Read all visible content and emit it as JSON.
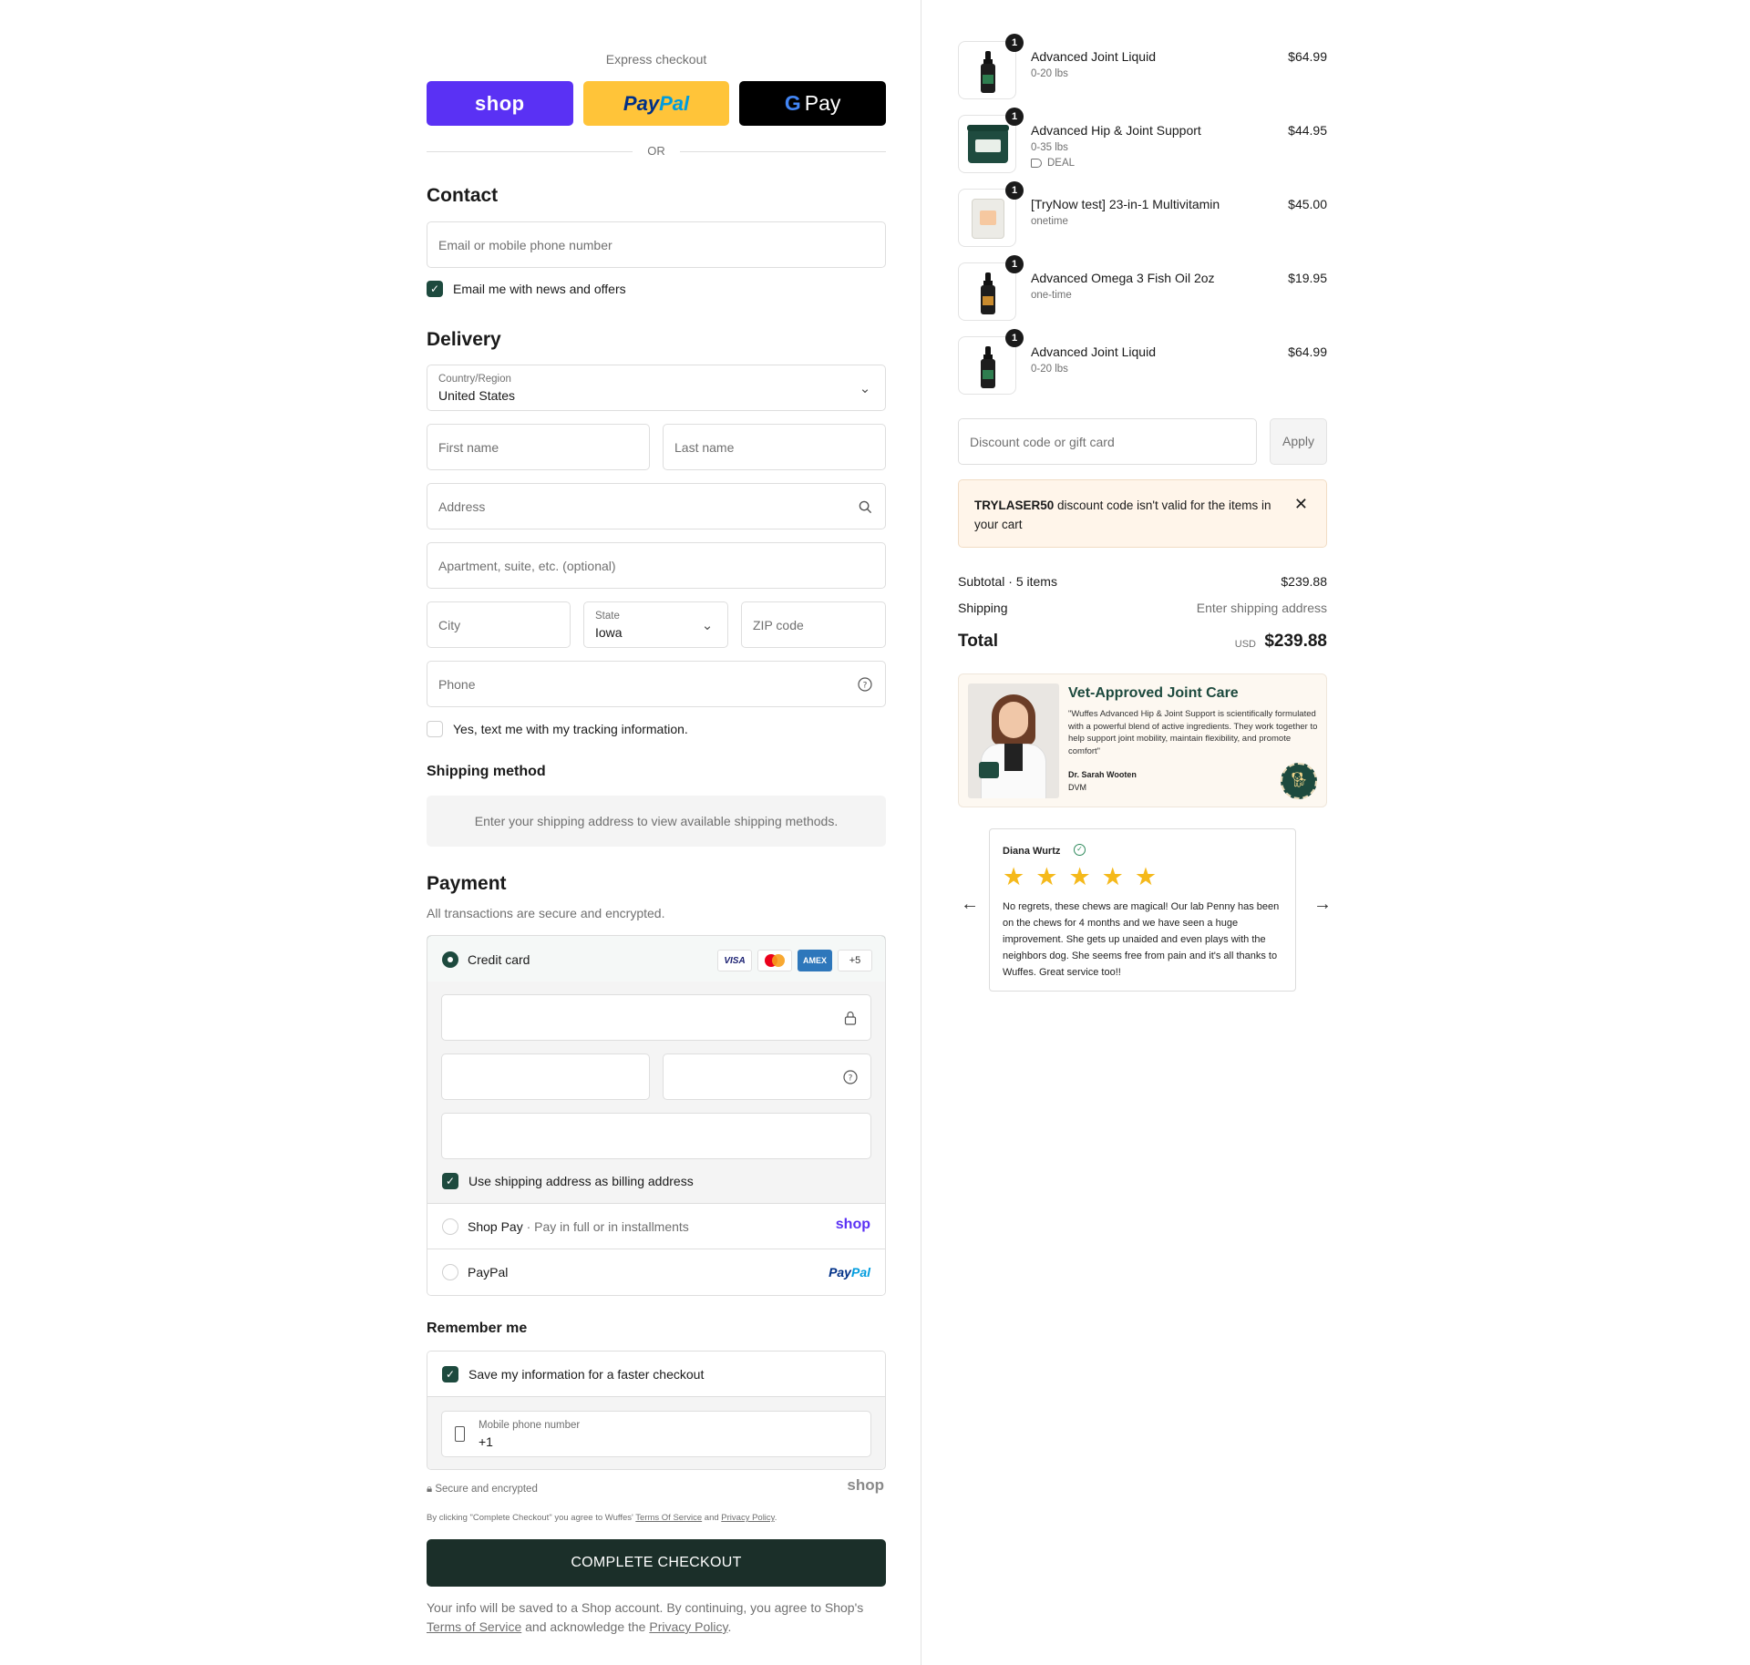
{
  "express": {
    "label": "Express checkout",
    "shop": "shop",
    "paypal_a": "Pay",
    "paypal_b": "Pal",
    "gpay_g": "G",
    "gpay": "Pay",
    "or": "OR"
  },
  "contact": {
    "title": "Contact",
    "email_placeholder": "Email or mobile phone number",
    "newsletter": "Email me with news and offers",
    "newsletter_checked": true
  },
  "delivery": {
    "title": "Delivery",
    "country_label": "Country/Region",
    "country_value": "United States",
    "first_name": "First name",
    "last_name": "Last name",
    "address": "Address",
    "apartment": "Apartment, suite, etc. (optional)",
    "city": "City",
    "state_label": "State",
    "state_value": "Iowa",
    "zip": "ZIP code",
    "phone": "Phone",
    "text_tracking": "Yes, text me with my tracking information."
  },
  "shipping": {
    "title": "Shipping method",
    "message": "Enter your shipping address to view available shipping methods."
  },
  "payment": {
    "title": "Payment",
    "subtitle": "All transactions are secure and encrypted.",
    "credit_card": "Credit card",
    "cards": [
      "VISA",
      "AMEX",
      "+5"
    ],
    "billing_same": "Use shipping address as billing address",
    "shop_pay": "Shop Pay",
    "shop_pay_sep": "·",
    "shop_pay_sub": "Pay in full or in installments",
    "shop_brand": "shop",
    "paypal": "PayPal",
    "paypal_brand_a": "Pay",
    "paypal_brand_b": "Pal"
  },
  "remember": {
    "title": "Remember me",
    "save_info": "Save my information for a faster checkout",
    "mobile_label": "Mobile phone number",
    "mobile_value": "+1"
  },
  "footer": {
    "secure": "Secure and encrypted",
    "shop_brand": "shop",
    "legal_pre": "By clicking \"Complete Checkout\" you agree to Wuffes'",
    "legal_terms": "Terms Of Service",
    "legal_and": "and",
    "legal_privacy": "Privacy Policy",
    "legal_end": ".",
    "cta": "COMPLETE CHECKOUT",
    "note_a": "Your info will be saved to a Shop account. By continuing, you agree to Shop's",
    "note_terms": "Terms of Service",
    "note_b": "and acknowledge the",
    "note_privacy": "Privacy Policy",
    "note_end": "."
  },
  "cart": {
    "items": [
      {
        "qty": "1",
        "name": "Advanced Joint Liquid",
        "variant": "0-20 lbs",
        "price": "$64.99",
        "image": "bottle"
      },
      {
        "qty": "1",
        "name": "Advanced Hip & Joint Support",
        "variant": "0-35 lbs",
        "deal": "DEAL",
        "price": "$44.95",
        "image": "jar"
      },
      {
        "qty": "1",
        "name": "[TryNow test] 23-in-1 Multivitamin",
        "variant": "onetime",
        "price": "$45.00",
        "image": "bag"
      },
      {
        "qty": "1",
        "name": "Advanced Omega 3 Fish Oil 2oz",
        "variant": "one-time",
        "price": "$19.95",
        "image": "bottle"
      },
      {
        "qty": "1",
        "name": "Advanced Joint Liquid",
        "variant": "0-20 lbs",
        "price": "$64.99",
        "image": "bottle"
      }
    ],
    "discount_placeholder": "Discount code or gift card",
    "apply": "Apply",
    "alert_code": "TRYLASER50",
    "alert_msg": "discount code isn't valid for the items in your cart",
    "subtotal_label": "Subtotal · 5 items",
    "subtotal": "$239.88",
    "shipping_label": "Shipping",
    "shipping_value": "Enter shipping address",
    "total_label": "Total",
    "currency": "USD",
    "total": "$239.88"
  },
  "vet": {
    "title": "Vet-Approved Joint Care",
    "quote": "\"Wuffes Advanced Hip & Joint Support is scientifically formulated with a powerful blend of active ingredients. They work together to help support joint mobility, maintain flexibility, and promote comfort\"",
    "name": "Dr. Sarah Wooten",
    "credential": "DVM"
  },
  "review": {
    "name": "Diana Wurtz",
    "rating": 5,
    "text": "No regrets, these chews are magical! Our lab Penny has been on the chews for 4 months and we have seen a huge improvement. She gets up unaided and even plays with the neighbors dog. She seems free from pain and it's all thanks to Wuffes. Great service too!!"
  },
  "icons": {
    "chevron": "chevron-down-icon",
    "search": "search-icon",
    "help": "help-circle-icon",
    "lock": "lock-icon",
    "close": "close-icon",
    "arrow_left": "arrow-left-icon",
    "arrow_right": "arrow-right-icon"
  },
  "colors": {
    "accent": "#1d4a3e",
    "cta": "#1b2f29",
    "shop_purple": "#5a31f4",
    "paypal_yellow": "#ffc439",
    "star": "#f5b91b",
    "alert_bg": "#fff5ea"
  }
}
